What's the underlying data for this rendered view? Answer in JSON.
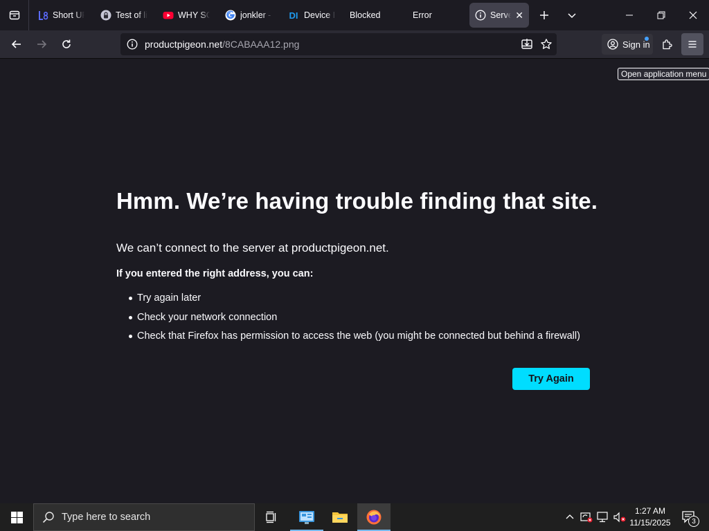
{
  "browser": {
    "tabs": [
      {
        "title": "Short UR",
        "icon": "link-favicon"
      },
      {
        "title": "Test of lin",
        "icon": "lock-favicon"
      },
      {
        "title": "WHY SO",
        "icon": "youtube-favicon"
      },
      {
        "title": "jonkler -",
        "icon": "google-favicon"
      },
      {
        "title": "Device In",
        "icon": "di-favicon"
      },
      {
        "title": "Blocked",
        "icon": "none"
      },
      {
        "title": "Error",
        "icon": "none"
      },
      {
        "title": "Server",
        "icon": "info-favicon",
        "active": true
      }
    ],
    "favicon_text": {
      "di": "DI"
    },
    "url": {
      "host": "productpigeon.net",
      "path": "/8CABAAA12.png"
    },
    "signin_label": "Sign in",
    "menu_tooltip": "Open application menu"
  },
  "error_page": {
    "title": "Hmm. We’re having trouble finding that site.",
    "description": "We can’t connect to the server at productpigeon.net.",
    "subheading": "If you entered the right address, you can:",
    "suggestions": [
      "Try again later",
      "Check your network connection",
      "Check that Firefox has permission to access the web (you might be connected but behind a firewall)"
    ],
    "try_again_label": "Try Again"
  },
  "taskbar": {
    "search_placeholder": "Type here to search",
    "time": "1:27 AM",
    "date": "11/15/2025",
    "notification_count": "3"
  },
  "colors": {
    "page_bg": "#1c1b22",
    "toolbar_bg": "#2b2a33",
    "accent_button": "#00ddff",
    "taskbar_bg": "#1f1f1f"
  }
}
